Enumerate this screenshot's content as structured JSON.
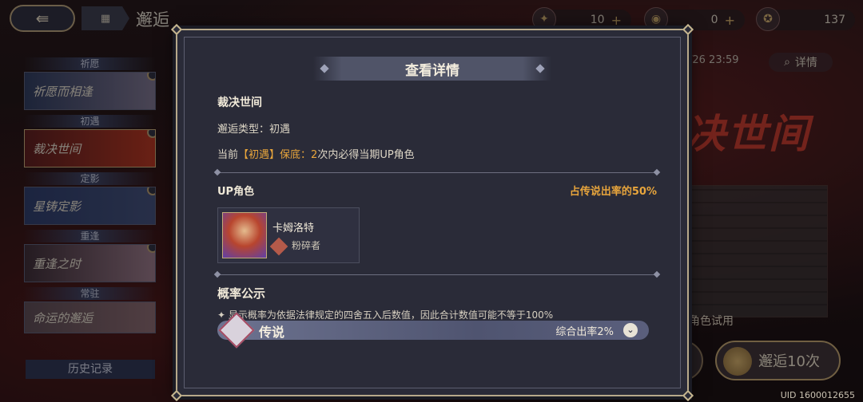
{
  "topbar": {
    "title": "邂逅",
    "resources": [
      {
        "icon": "crystal-icon",
        "value": "10",
        "has_plus": true
      },
      {
        "icon": "orb-icon",
        "value": "0",
        "has_plus": true
      },
      {
        "icon": "gold-coin-icon",
        "value": "137",
        "has_plus": false
      }
    ]
  },
  "sidebar": {
    "groups": [
      {
        "category": "祈愿",
        "banner": "祈愿而相逢"
      },
      {
        "category": "初遇",
        "banner": "裁决世间"
      },
      {
        "category": "定影",
        "banner": "星铸定影"
      },
      {
        "category": "重逢",
        "banner": "重逢之时"
      },
      {
        "category": "常驻",
        "banner": "命运的邂逅"
      }
    ],
    "history": "历史记录"
  },
  "right": {
    "date": "/26 23:59",
    "detail": "详情",
    "banner_title": "决世间",
    "trial": "角色试用",
    "pull10": "邂逅10次",
    "pull10_count": "10",
    "uid": "UID 1600012655"
  },
  "modal": {
    "header": "查看详情",
    "banner_name": "裁决世间",
    "type_label": "邂逅类型：",
    "type_value": "初遇",
    "pity_prefix": "当前",
    "pity_tag": "【初遇】保底：",
    "pity_count": "2",
    "pity_suffix": "次内必得当期UP角色",
    "up_label": "UP角色",
    "up_rate": "占传说出率的50%",
    "character": {
      "name": "卡姆洛特",
      "class": "粉碎者"
    },
    "prob_title": "概率公示",
    "prob_note": "✦ 显示概率为依据法律规定的四舍五入后数值，因此合计数值可能不等于100%",
    "rarity": {
      "label": "传说",
      "rate": "综合出率2%"
    }
  }
}
